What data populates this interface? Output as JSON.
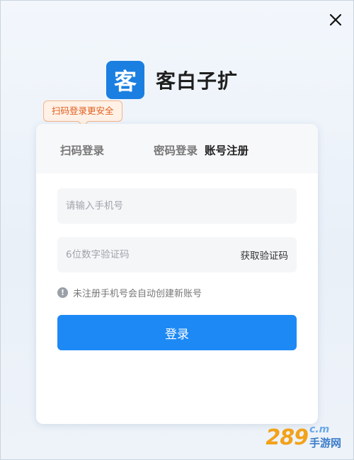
{
  "window": {
    "close_icon": "close-icon"
  },
  "logo": {
    "badge_char": "客",
    "name": "客白子扩"
  },
  "tooltip": {
    "text": "扫码登录更安全"
  },
  "tabs": {
    "qr": "扫码登录",
    "password": "密码登录",
    "extra": "账号注册"
  },
  "phone": {
    "placeholder": "请输入手机号"
  },
  "code": {
    "placeholder": "6位数字验证码",
    "get_code_label": "获取验证码"
  },
  "notice": {
    "icon": "info-icon",
    "text": "未注册手机号会自动创建新账号"
  },
  "login_button": {
    "label": "登录"
  },
  "watermark": {
    "number": "289",
    "com": "c.m",
    "cn": "手游网"
  },
  "colors": {
    "primary": "#1d89f5",
    "tooltip_text": "#e15f1f",
    "tooltip_bg": "#fff1e6"
  }
}
